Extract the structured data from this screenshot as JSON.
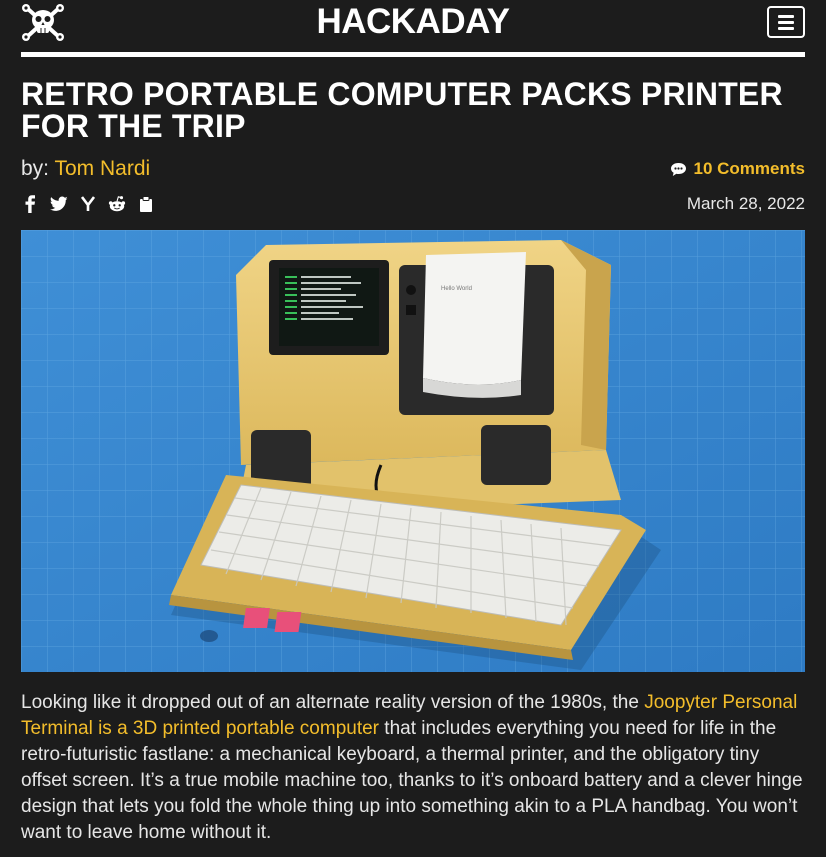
{
  "site": {
    "name": "HACKADAY"
  },
  "header": {
    "logo_icon": "skull-crossed-wrenches-icon",
    "menu_icon": "hamburger-menu-icon"
  },
  "article": {
    "title": "Retro Portable Computer Packs Printer For The Trip",
    "byline_prefix": "by:",
    "author": "Tom Nardi",
    "comments": "10 Comments",
    "date": "March 28, 2022",
    "share_icons": [
      "facebook-icon",
      "twitter-icon",
      "hacker-news-icon",
      "reddit-icon",
      "clipboard-icon"
    ],
    "body": {
      "before_link": "Looking like it dropped out of an alternate reality version of the 1980s, the ",
      "link_text": "Joopyter Personal Terminal is a 3D printed portable computer",
      "after_link": " that includes everything you need for life in the retro-futuristic fastlane: a mechanical keyboard, a thermal printer, and the obligatory tiny offset screen. It’s a true mobile machine too, thanks to it’s onboard battery and a clever hinge design that lets you fold the whole thing up into something akin to a PLA handbag. You won’t want to leave home without it."
    }
  },
  "colors": {
    "background": "#1c1c1c",
    "accent": "#f3bd2b",
    "text": "#f2f2f2"
  }
}
